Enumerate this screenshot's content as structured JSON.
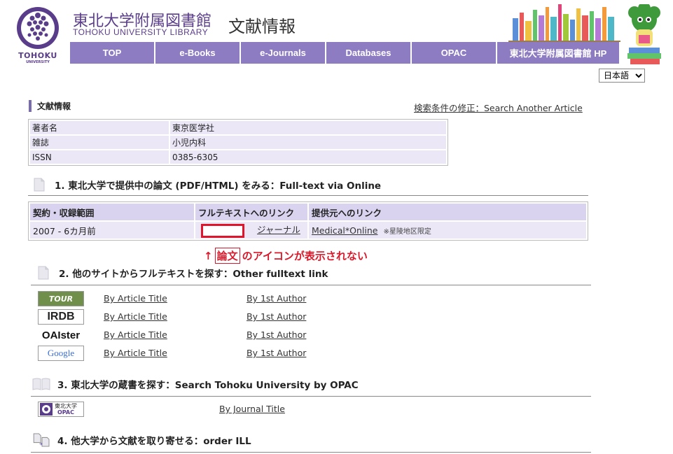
{
  "header": {
    "lib_name_jp": "東北大学附属図書館",
    "lib_name_en": "TOHOKU UNIVERSITY LIBRARY",
    "logo_word": "TOHOKU",
    "logo_sub": "UNIVERSITY",
    "page_heading": "文献情報",
    "brand_color": "#8e7cc3"
  },
  "nav": [
    "TOP",
    "e-Books",
    "e-Journals",
    "Databases",
    "OPAC",
    "東北大学附属図書館 HP"
  ],
  "lang": {
    "selected": "日本語"
  },
  "section_title": "文献情報",
  "search_another": "検索条件の修正：Search Another Article",
  "info": [
    {
      "label": "著者名",
      "value": "東京医学社"
    },
    {
      "label": "雑誌",
      "value": "小児内科"
    },
    {
      "label": "ISSN",
      "value": "0385-6305"
    }
  ],
  "sections": {
    "s1": "1. 東北大学で提供中の論文 (PDF/HTML) をみる：Full-text via Online",
    "s2": "2. 他のサイトからフルテキストを探す：Other fulltext link",
    "s3": "3. 東北大学の蔵書を探す：Search Tohoku University by OPAC",
    "s4": "4. 他大学から文献を取り寄せる：order ILL"
  },
  "fulltext": {
    "headers": [
      "契約・収録範囲",
      "フルテキストへのリンク",
      "提供元へのリンク"
    ],
    "coverage": "2007 - 6カ月前",
    "journal_link": "ジャーナル",
    "provider": "Medical*Online",
    "provider_note": "※星陵地区限定"
  },
  "annotation": {
    "arrow": "↑",
    "boxed": "論文",
    "text": "のアイコンが表示されない"
  },
  "other_links": [
    {
      "logo": "TOUR",
      "title": "By Article Title",
      "author": "By 1st Author"
    },
    {
      "logo": "IRDB",
      "title": "By Article Title",
      "author": "By 1st Author"
    },
    {
      "logo": "OAIster",
      "title": "By Article Title",
      "author": "By 1st Author"
    },
    {
      "logo": "Google",
      "title": "By Article Title",
      "author": "By 1st Author"
    }
  ],
  "opac": {
    "logo_line1": "東北大学",
    "logo_line2": "OPAC",
    "link": "By Journal Title"
  }
}
